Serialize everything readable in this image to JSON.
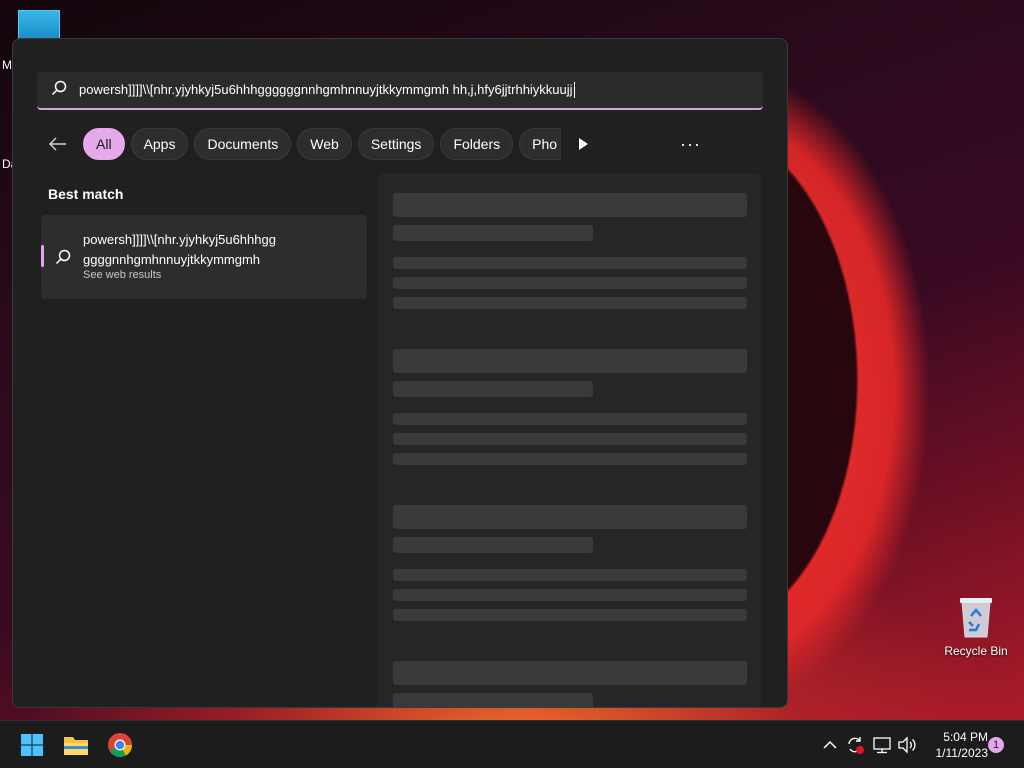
{
  "desktop": {
    "fragment_1": "M",
    "fragment_2": "Da",
    "recycle_bin_label": "Recycle Bin"
  },
  "search": {
    "query": "powersh]]]]\\\\[nhr.yjyhkyj5u6hhhggggggnnhgmhnnuyjtkkymmgmh hh,j,hfy6jjtrhhiykkuujj",
    "accent_color": "#e5a8ea"
  },
  "filters": {
    "back_icon": "back-arrow-icon",
    "chips": [
      {
        "label": "All",
        "active": true
      },
      {
        "label": "Apps"
      },
      {
        "label": "Documents"
      },
      {
        "label": "Web"
      },
      {
        "label": "Settings"
      },
      {
        "label": "Folders"
      },
      {
        "label": "Pho"
      }
    ],
    "more_label": "···"
  },
  "results": {
    "section_label": "Best match",
    "best_match": {
      "title_line1": "powersh]]]]\\\\[nhr.yjyhkyj5u6hhhgg",
      "title_line2": "ggggnnhgmhnnuyjtkkymmgmh",
      "subtitle": "See web results"
    }
  },
  "taskbar": {
    "apps": [
      "windows-start-icon",
      "file-explorer-icon",
      "chrome-icon"
    ],
    "time": "5:04 PM",
    "date": "1/11/2023",
    "notification_count": "1"
  }
}
